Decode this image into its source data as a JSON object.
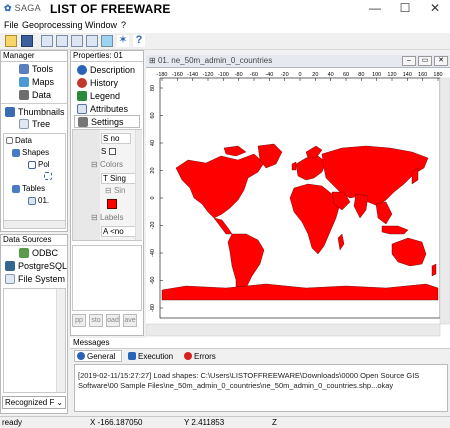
{
  "window": {
    "logo": "SAGA",
    "title": "LIST OF FREEWARE",
    "min": "—",
    "max": "☐",
    "close": "✕"
  },
  "menu": [
    "File",
    "Geoprocessing",
    "Window",
    "?"
  ],
  "manager": {
    "header": "Manager",
    "buttons": [
      "Tools",
      "Maps",
      "Data",
      "Thumbnails",
      "Tree"
    ],
    "tree": [
      "Data",
      "Shapes",
      "Pol",
      "Tables",
      "01."
    ]
  },
  "datasources": {
    "header": "Data Sources",
    "items": [
      "ODBC",
      "PostgreSQL",
      "File System"
    ],
    "dropdown": "Recognized F"
  },
  "properties": {
    "header": "Properties: 01",
    "tabs": [
      "Description",
      "History",
      "Legend",
      "Attributes",
      "Settings"
    ],
    "rows": [
      "S no",
      "S",
      "Colors",
      "T Sing",
      "Sin",
      "Labels",
      "A <no"
    ],
    "bottom_btns": [
      "pp",
      "sto",
      "oad",
      "ave"
    ]
  },
  "map": {
    "title": "01. ne_50m_admin_0_countries",
    "x_ticks": [
      "-180",
      "-160",
      "-140",
      "-120",
      "-100",
      "-80",
      "-60",
      "-40",
      "-20",
      "0",
      "20",
      "40",
      "60",
      "80",
      "100",
      "120",
      "140",
      "160",
      "180"
    ],
    "y_ticks": [
      "80",
      "60",
      "40",
      "20",
      "0",
      "-20",
      "-40",
      "-60",
      "-80"
    ],
    "land_color": "#ff0000"
  },
  "messages": {
    "header": "Messages",
    "tabs": [
      "General",
      "Execution",
      "Errors"
    ],
    "text": "[2019-02-11/15:27:27] Load shapes: C:\\Users\\LISTOFFREEWARE\\Downloads\\0000 Open Source GIS Software\\00 Sample Files\\ne_50m_admin_0_countries\\ne_50m_admin_0_countries.shp...okay"
  },
  "status": {
    "state": "ready",
    "x": "X -166.187050",
    "y": "Y 2.411853",
    "z": "Z"
  }
}
